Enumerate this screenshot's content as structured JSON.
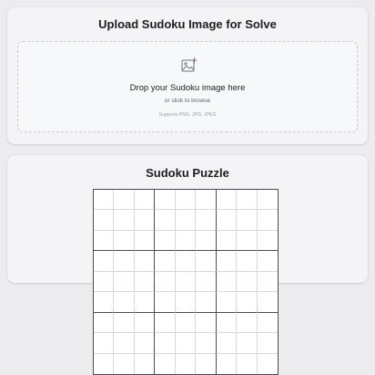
{
  "upload": {
    "title": "Upload Sudoku Image for Solve",
    "icon": "image-add-icon",
    "drop_title": "Drop your Sudoku image here",
    "drop_subtitle": "or click to browse",
    "supported_formats": "Supports PNG, JPG, JPEG"
  },
  "puzzle": {
    "title": "Sudoku Puzzle",
    "cells": [
      "",
      "",
      "",
      "",
      "",
      "",
      "",
      "",
      "",
      "",
      "",
      "",
      "",
      "",
      "",
      "",
      "",
      "",
      "",
      "",
      "",
      "",
      "",
      "",
      "",
      "",
      "",
      "",
      "",
      "",
      "",
      "",
      "",
      "",
      "",
      "",
      "",
      "",
      "",
      "",
      "",
      "",
      "",
      "",
      "",
      "",
      "",
      "",
      "",
      "",
      "",
      "",
      "",
      "",
      "",
      "",
      "",
      "",
      "",
      "",
      "",
      "",
      "",
      "",
      "",
      "",
      "",
      "",
      "",
      "",
      "",
      "",
      "",
      "",
      "",
      "",
      "",
      "",
      "",
      "",
      ""
    ]
  }
}
